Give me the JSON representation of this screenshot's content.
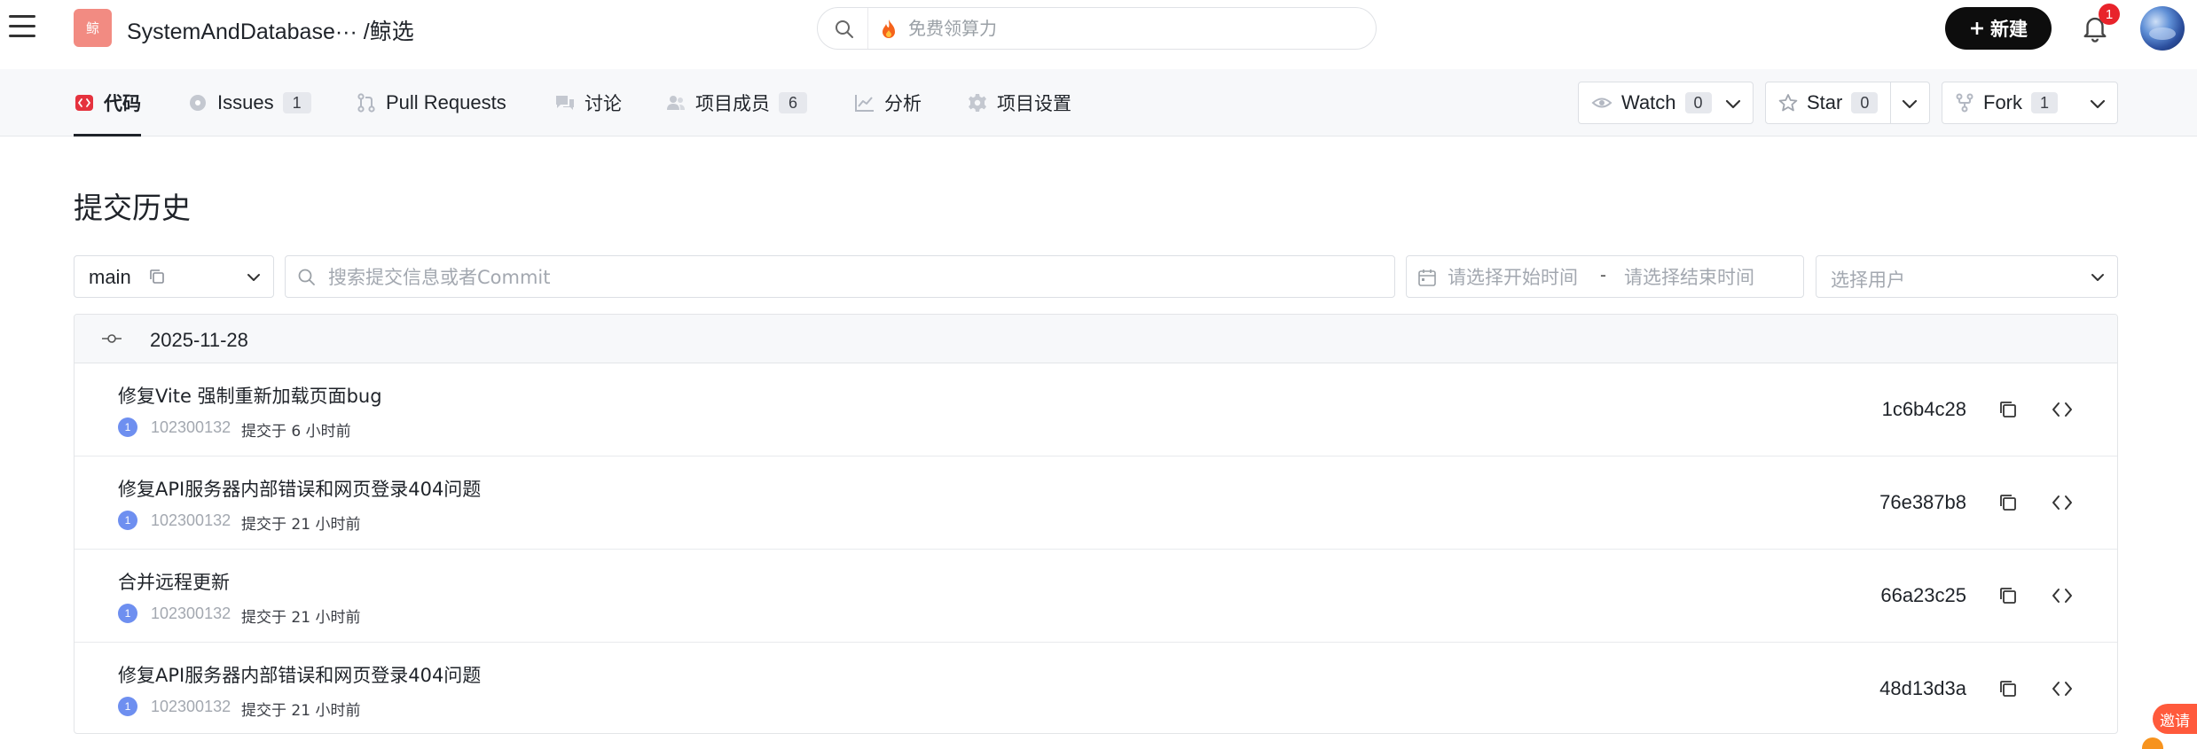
{
  "header": {
    "repo_logo_text": "鲸",
    "repo_title": "SystemAndDatabase··· /鲸选",
    "search_placeholder": "免费领算力",
    "new_button_label": "新建",
    "notification_count": "1"
  },
  "repo_nav": {
    "tabs": [
      {
        "label": "代码",
        "count": "",
        "icon": "code-icon",
        "active": true
      },
      {
        "label": "Issues",
        "count": "1",
        "icon": "issue-icon",
        "active": false
      },
      {
        "label": "Pull Requests",
        "count": "",
        "icon": "pull-request-icon",
        "active": false
      },
      {
        "label": "讨论",
        "count": "",
        "icon": "discussion-icon",
        "active": false
      },
      {
        "label": "项目成员",
        "count": "6",
        "icon": "members-icon",
        "active": false
      },
      {
        "label": "分析",
        "count": "",
        "icon": "analytics-icon",
        "active": false
      },
      {
        "label": "项目设置",
        "count": "",
        "icon": "settings-gear-icon",
        "active": false
      }
    ],
    "actions": {
      "watch": {
        "label": "Watch",
        "count": "0"
      },
      "star": {
        "label": "Star",
        "count": "0"
      },
      "fork": {
        "label": "Fork",
        "count": "1"
      }
    }
  },
  "main": {
    "title": "提交历史",
    "branch": "main",
    "commit_search_placeholder": "搜索提交信息或者Commit",
    "date_start_placeholder": "请选择开始时间",
    "date_separator": "-",
    "date_end_placeholder": "请选择结束时间",
    "user_select_placeholder": "选择用户",
    "group_date": "2025-11-28",
    "commits": [
      {
        "message": "修复Vite 强制重新加载页面bug",
        "author_initial": "1",
        "author": "102300132",
        "time": "提交于 6 小时前",
        "sha": "1c6b4c28"
      },
      {
        "message": "修复API服务器内部错误和网页登录404问题",
        "author_initial": "1",
        "author": "102300132",
        "time": "提交于 21 小时前",
        "sha": "76e387b8"
      },
      {
        "message": "合并远程更新",
        "author_initial": "1",
        "author": "102300132",
        "time": "提交于 21 小时前",
        "sha": "66a23c25"
      },
      {
        "message": "修复API服务器内部错误和网页登录404问题",
        "author_initial": "1",
        "author": "102300132",
        "time": "提交于 21 小时前",
        "sha": "48d13d3a"
      }
    ]
  },
  "floating": {
    "invite_label": "邀请"
  },
  "colors": {
    "brand_logo": "#f28b82",
    "primary_button": "#0d0d0d",
    "badge_red": "#e8232b",
    "active_tab_icon": "#e5323e",
    "author_avatar": "#6e8ff0",
    "invite": "#ff5a3c"
  }
}
